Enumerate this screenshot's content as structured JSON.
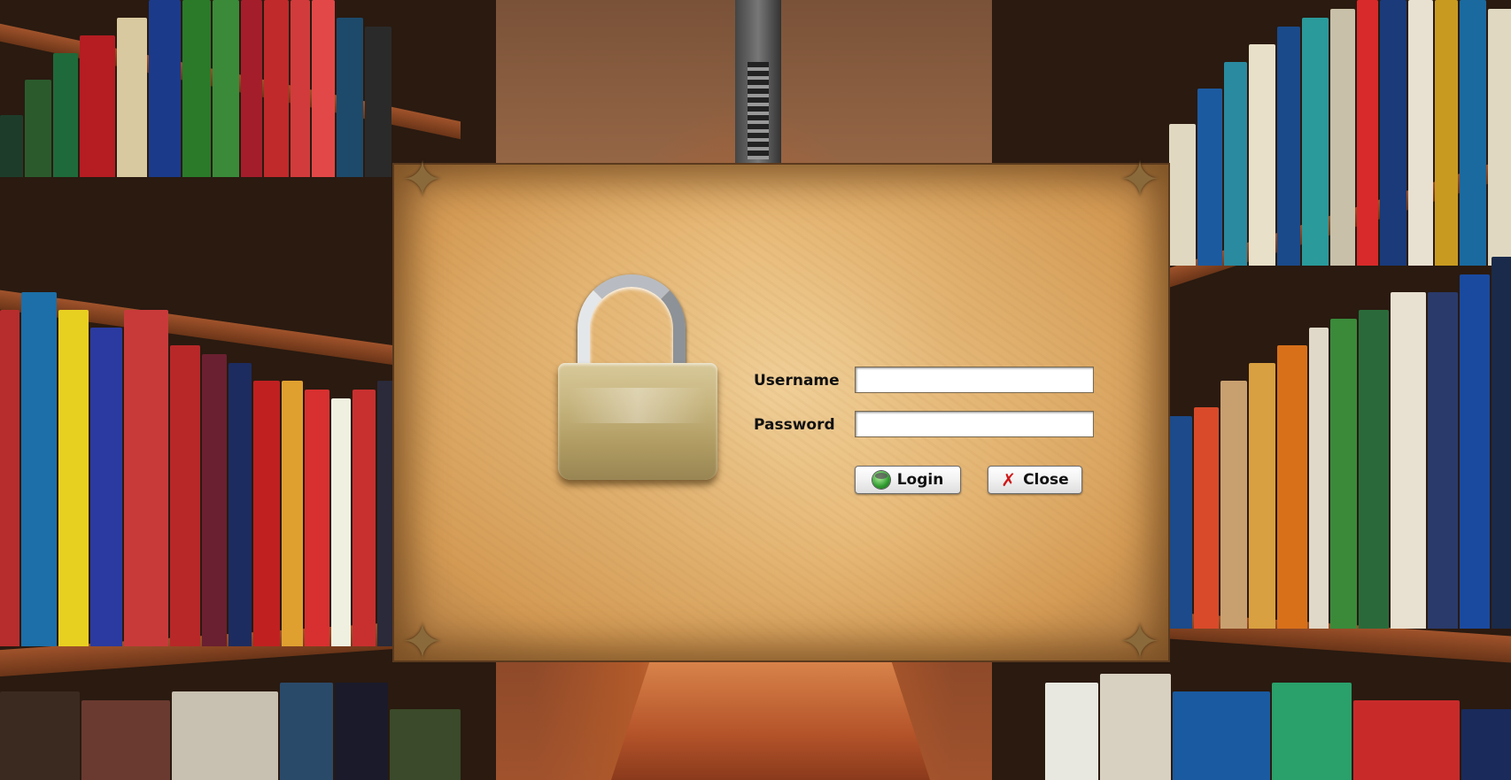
{
  "window": {
    "title": ""
  },
  "login": {
    "username_label": "Username",
    "password_label": "Password",
    "username_value": "",
    "password_value": "",
    "login_button": "Login",
    "close_button": "Close"
  },
  "icons": {
    "padlock": "padlock-icon",
    "login": "green-orb-icon",
    "close": "red-x-icon"
  },
  "colors": {
    "close_icon": "#d01818",
    "login_icon": "#2e9a2e"
  }
}
